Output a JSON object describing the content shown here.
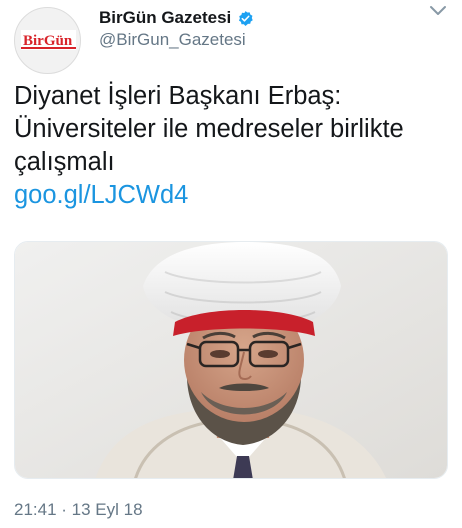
{
  "app": {
    "name": "Twitter"
  },
  "account": {
    "display_name": "BirGün Gazetesi",
    "handle": "@BirGun_Gazetesi",
    "verified": true,
    "avatar_icon": "birgun-logo",
    "avatar_logo_text": "BirGün"
  },
  "menu": {
    "icon": "chevron-down-icon"
  },
  "tweet": {
    "lines": [
      "Diyanet İşleri Başkanı Erbaş:",
      "Üniversiteler ile medreseler birlikte",
      "çalışmalı"
    ],
    "link": "goo.gl/LJCWd4",
    "timestamp": "21:41 · 13 Eyl 18"
  },
  "colors": {
    "link_blue": "#1b95e0",
    "secondary_gray": "#657786",
    "text_dark": "#14171a",
    "verified_blue": "#1da1f2",
    "brand_red": "#d8232a"
  }
}
